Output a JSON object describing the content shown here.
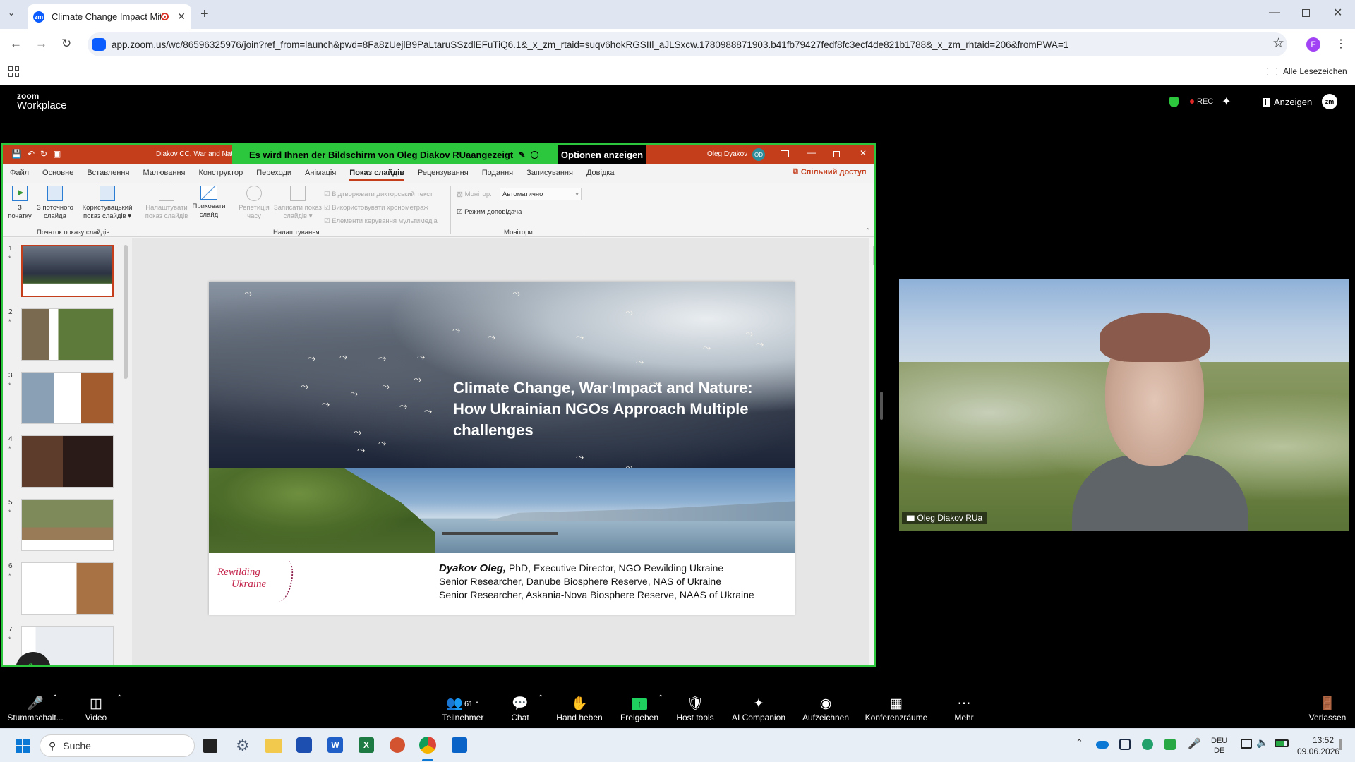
{
  "browser": {
    "tab_title": "Climate Change Impact Mit",
    "tab_favicon": "zm",
    "url": "app.zoom.us/wc/86596325976/join?ref_from=launch&pwd=8Fa8zUejlB9PaLtaruSSzdlEFuTiQ6.1&_x_zm_rtaid=suqv6hokRGSIIl_aJLSxcw.1780988871903.b41fb79427fedf8fc3ecf4de821b1788&_x_zm_rhtaid=206&fromPWA=1",
    "bookmarks_label": "Alle Lesezeichen",
    "profile_initial": "F"
  },
  "zoom": {
    "logo_line1": "zoom",
    "logo_line2": "Workplace",
    "rec_label": "REC",
    "view_label": "Anzeigen",
    "avatar": "zm",
    "share_banner": "Es wird Ihnen der Bildschirm von  Oleg Diakov RUaangezeigt",
    "options_label": "Optionen anzeigen",
    "participant_name": "Oleg Diakov RUa"
  },
  "ppt": {
    "doc_title": "Diakov CC, War and Natu",
    "user_name": "Oleg Dyakov",
    "user_initials": "OD",
    "menu": [
      "Файл",
      "Основне",
      "Вставлення",
      "Малювання",
      "Конструктор",
      "Переходи",
      "Анімація",
      "Показ слайдів",
      "Рецензування",
      "Подання",
      "Записування",
      "Довідка"
    ],
    "active_menu_index": 7,
    "share_label": "Спільний доступ",
    "ribbon": {
      "from_start_1": "З",
      "from_start_2": "початку",
      "from_current_1": "З поточного",
      "from_current_2": "слайда",
      "custom_1": "Користувацький",
      "custom_2": "показ слайдів",
      "group1": "Початок показу слайдів",
      "setup_1": "Налаштувати",
      "setup_2": "показ слайдів",
      "hide_1": "Приховати",
      "hide_2": "слайд",
      "rehearse_1": "Репетиція",
      "rehearse_2": "часу",
      "record_1": "Записати показ",
      "record_2": "слайдів",
      "check1": "Відтворювати дикторський текст",
      "check2": "Використовувати хронометраж",
      "check3": "Елементи керування мультимедіа",
      "group2": "Налаштування",
      "monitor_label": "Монітор:",
      "monitor_value": "Автоматично",
      "presenter_view": "Режим доповідача",
      "group3": "Монітори"
    },
    "slide_numbers": [
      "1",
      "2",
      "3",
      "4",
      "5",
      "6",
      "7"
    ],
    "slide": {
      "title": "Climate Change, War Impact and Nature: How Ukrainian NGOs Approach Multiple challenges",
      "logo_line1": "Rewilding",
      "logo_line2": "Ukraine",
      "author": "Dyakov Oleg,",
      "line1_rest": " PhD, Executive Director, NGO Rewilding Ukraine",
      "line2": "Senior Researcher, Danube Biosphere Reserve, NAS of Ukraine",
      "line3": "Senior Researcher, Askania-Nova Biosphere Reserve, NAAS of Ukraine"
    }
  },
  "toolbar": {
    "mute": "Stummschalt...",
    "video": "Video",
    "participants": "Teilnehmer",
    "participants_count": "61",
    "chat": "Chat",
    "raise_hand": "Hand heben",
    "share": "Freigeben",
    "host_tools": "Host tools",
    "ai": "AI Companion",
    "record": "Aufzeichnen",
    "rooms": "Konferenzräume",
    "more": "Mehr",
    "leave": "Verlassen"
  },
  "taskbar": {
    "search_placeholder": "Suche",
    "lang1": "DEU",
    "lang2": "DE",
    "time": "13:52",
    "date": "09.06.2026"
  },
  "colors": {
    "accent_green": "#2cc73d",
    "ppt_red": "#c43e1c",
    "zoom_blue": "#0b5cff"
  }
}
